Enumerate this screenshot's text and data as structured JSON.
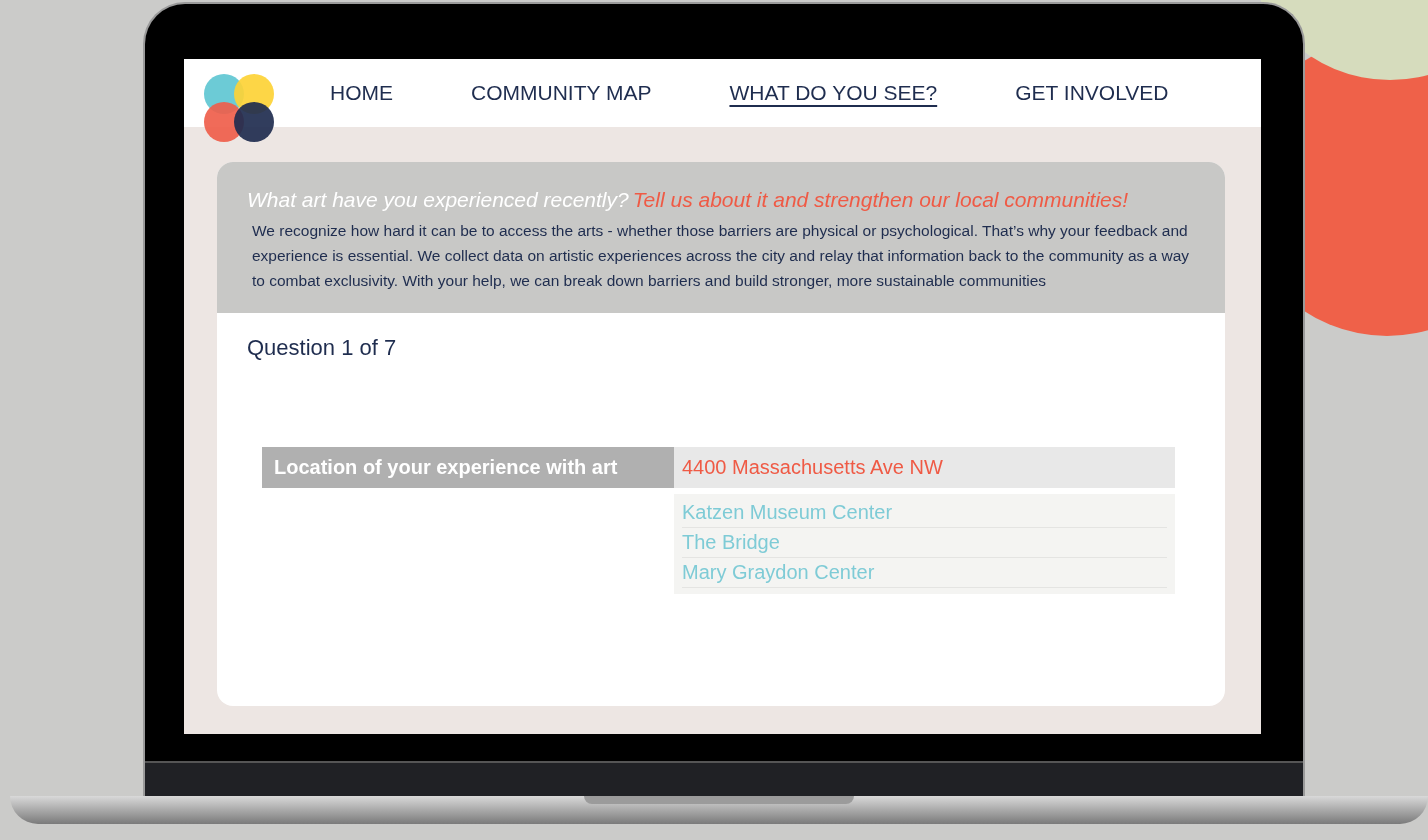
{
  "nav": {
    "items": [
      {
        "label": "HOME",
        "selected": false
      },
      {
        "label": "COMMUNITY MAP",
        "selected": false
      },
      {
        "label": "WHAT DO YOU SEE?",
        "selected": true
      },
      {
        "label": "GET INVOLVED",
        "selected": false
      }
    ]
  },
  "intro": {
    "question": "What art have you experienced recently?",
    "call_to_action": "Tell us about it and strengthen our local communities!",
    "body": "We recognize how hard it can be to access the arts - whether those barriers are physical or psychological. That’s why your feedback and experience is essential. We collect data on artistic experiences across the city and relay that information back to the community as a way to combat exclusivity. With your help, we can break down barriers and build stronger, more sustainable communities"
  },
  "question_counter": "Question 1 of 7",
  "location": {
    "label": "Location of your experience with art",
    "value": "4400 Massachusetts Ave NW",
    "suggestions": [
      "Katzen Museum Center",
      "The Bridge",
      "Mary Graydon Center"
    ]
  }
}
